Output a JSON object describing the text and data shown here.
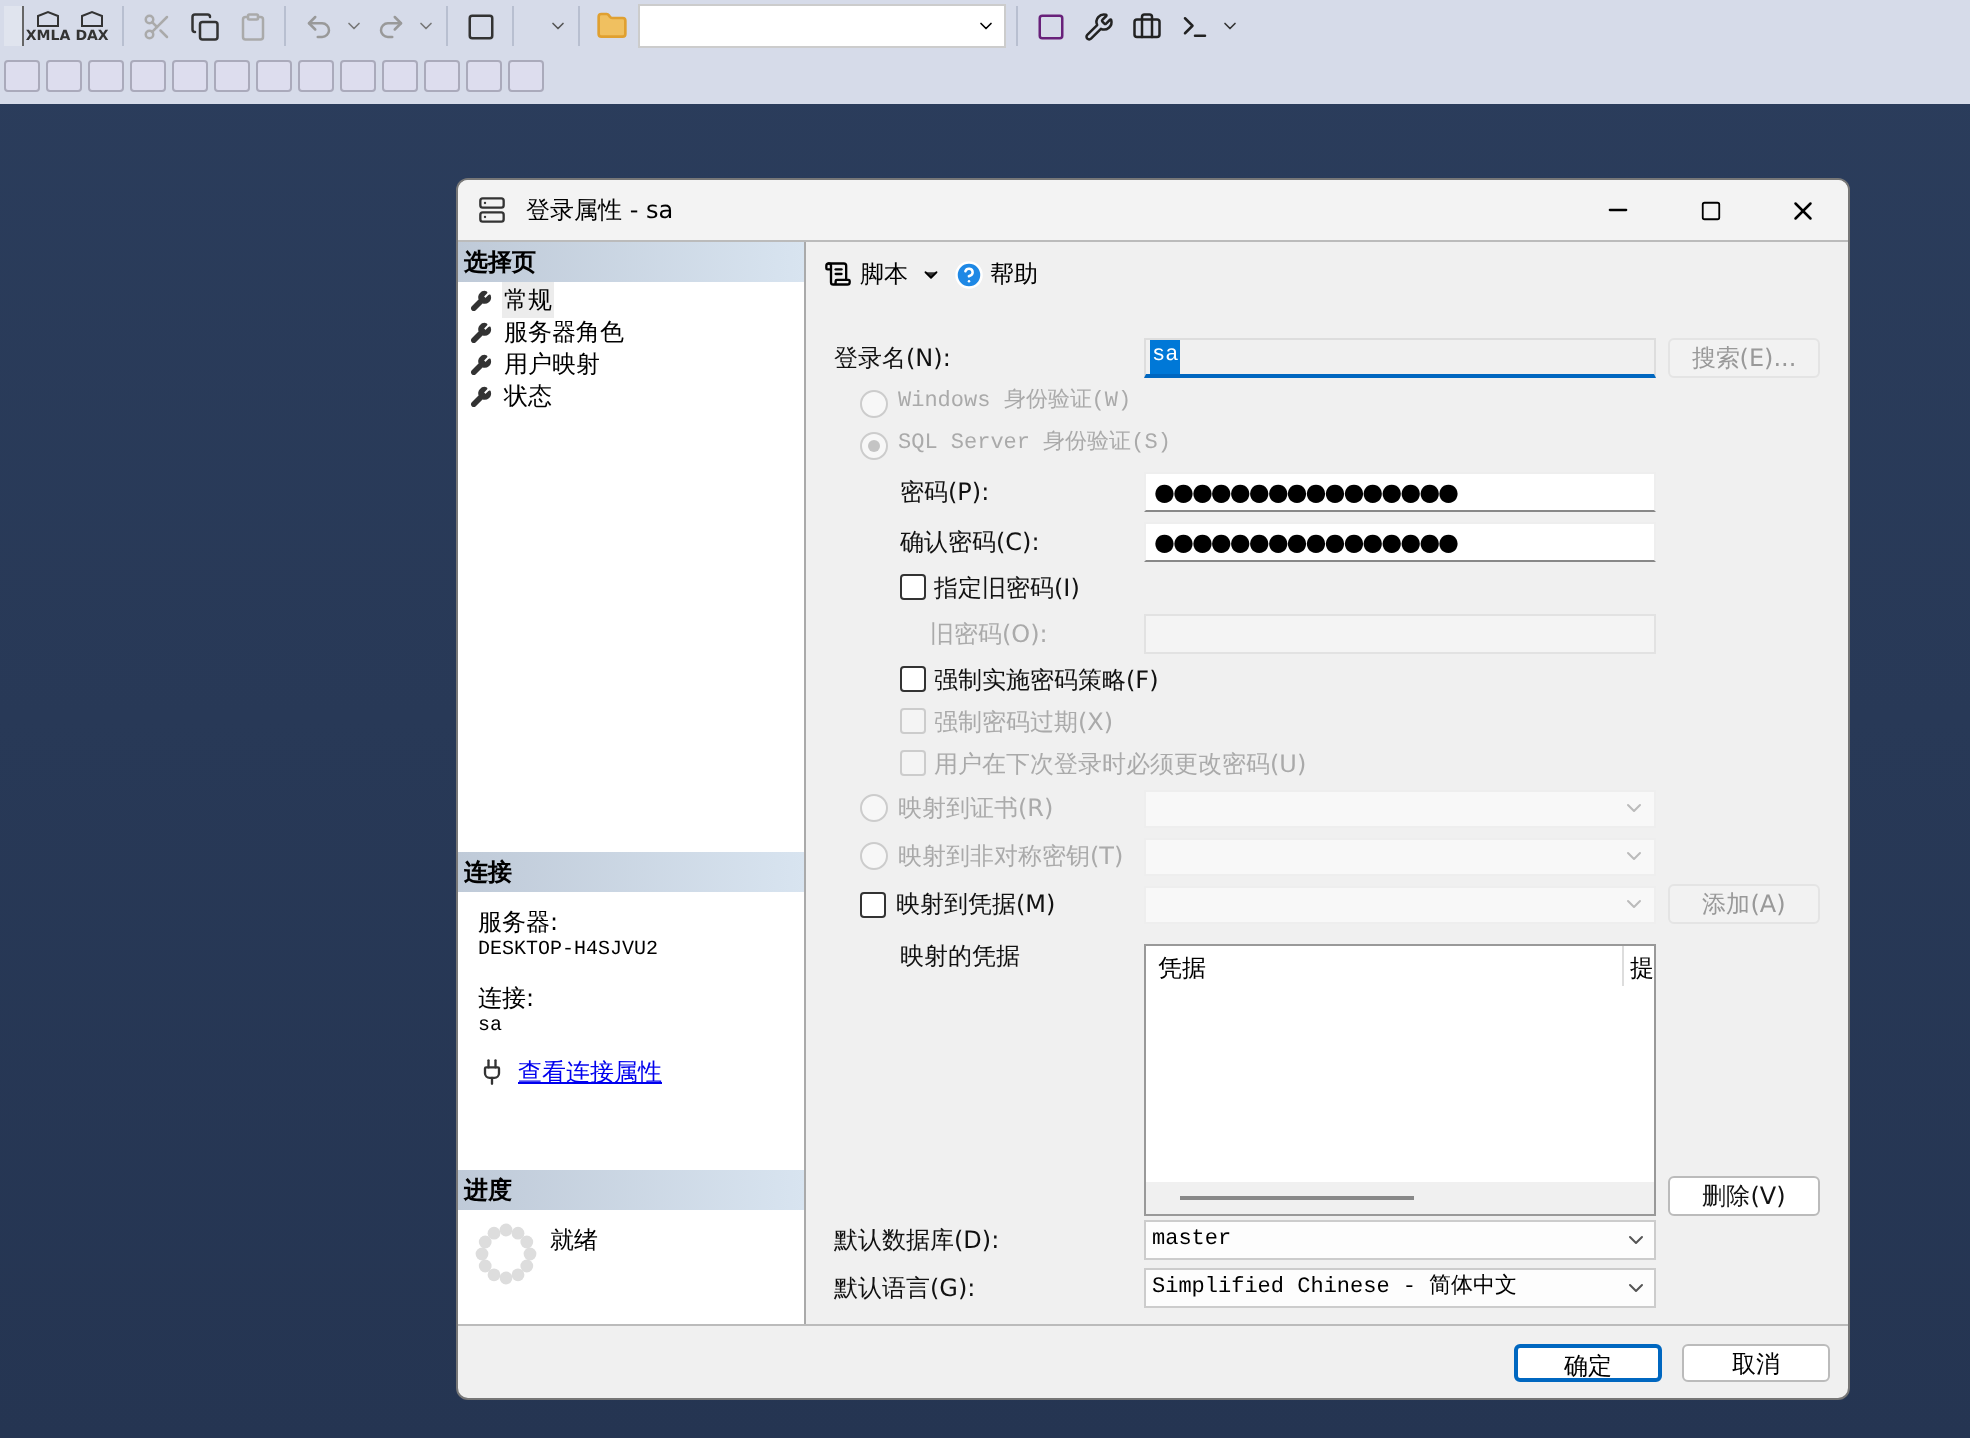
{
  "toolbar": {
    "query_labels": [
      {
        "label": "XMLA"
      },
      {
        "label": "DAX"
      }
    ]
  },
  "dialog": {
    "title": "登录属性 - sa",
    "pages_header": "选择页",
    "pages": [
      {
        "label": "常规",
        "selected": true
      },
      {
        "label": "服务器角色",
        "selected": false
      },
      {
        "label": "用户映射",
        "selected": false
      },
      {
        "label": "状态",
        "selected": false
      }
    ],
    "connection": {
      "header": "连接",
      "server_label": "服务器:",
      "server": "DESKTOP-H4SJVU2",
      "connection_label": "连接:",
      "connection": "sa",
      "link": "查看连接属性"
    },
    "progress": {
      "header": "进度",
      "status": "就绪"
    },
    "pane_toolbar": {
      "script": "脚本",
      "help": "帮助"
    },
    "form": [
      {
        "kind": "text",
        "label": "登录名(N):",
        "value": "sa",
        "focused": true,
        "button": {
          "label": "搜索(E)...",
          "disabled": true
        }
      },
      {
        "kind": "radio",
        "label": "Windows 身份验证(W)",
        "selected": false,
        "disabled": true
      },
      {
        "kind": "radio",
        "label": "SQL Server 身份验证(S)",
        "selected": true,
        "disabled": true
      },
      {
        "kind": "password",
        "label": "密码(P):",
        "value": "●●●●●●●●●●●●●●●●",
        "disabled": false
      },
      {
        "kind": "password",
        "label": "确认密码(C):",
        "value": "●●●●●●●●●●●●●●●●",
        "disabled": false
      },
      {
        "kind": "checkbox",
        "label": "指定旧密码(I)",
        "checked": false,
        "disabled": false
      },
      {
        "kind": "password",
        "label": "旧密码(O):",
        "disabled": true
      },
      {
        "kind": "checkbox",
        "label": "强制实施密码策略(F)",
        "checked": false,
        "disabled": false
      },
      {
        "kind": "checkbox",
        "label": "强制密码过期(X)",
        "checked": false,
        "disabled": true
      },
      {
        "kind": "checkbox",
        "label": "用户在下次登录时必须更改密码(U)",
        "checked": false,
        "disabled": true
      },
      {
        "kind": "radio-select",
        "label": "映射到证书(R)",
        "selected": false,
        "disabled": true
      },
      {
        "kind": "radio-select",
        "label": "映射到非对称密钥(T)",
        "selected": false,
        "disabled": true
      },
      {
        "kind": "checkbox-select",
        "label": "映射到凭据(M)",
        "checked": false,
        "disabled": false,
        "button": {
          "label": "添加(A)",
          "disabled": true
        }
      },
      {
        "kind": "list",
        "label": "映射的凭据",
        "columns": [
          "凭据",
          "提"
        ],
        "button": {
          "label": "删除(V)",
          "disabled": false
        }
      },
      {
        "kind": "select",
        "label": "默认数据库(D):",
        "value": "master"
      },
      {
        "kind": "select",
        "label": "默认语言(G):",
        "value": "Simplified Chinese - 简体中文"
      }
    ],
    "buttons": [
      {
        "label": "确定",
        "default": true
      },
      {
        "label": "取消",
        "default": false
      }
    ]
  }
}
